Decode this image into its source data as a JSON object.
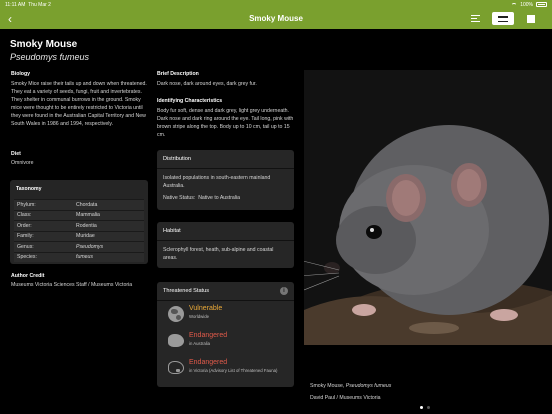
{
  "status_bar": {
    "time": "11:11 AM",
    "date": "Thu Mar 2",
    "battery": "100%"
  },
  "navbar": {
    "title": "Smoky Mouse"
  },
  "species": {
    "common_name": "Smoky Mouse",
    "scientific_name": "Pseudomys fumeus"
  },
  "biology": {
    "heading": "Biology",
    "text": "Smoky Mice raise their tails up and down when threatened. They eat a variety of seeds, fungi, fruit and invertebrates. They shelter in communal burrows in the ground. Smoky mice were thought to be entirely restricted to Victoria until they were found in the Australian Capital Territory and New South Wales in 1986 and 1994, respectively."
  },
  "diet": {
    "heading": "Diet",
    "text": "Omnivore"
  },
  "taxonomy": {
    "heading": "Taxonomy",
    "rows": [
      {
        "key": "Phylum:",
        "value": "Chordata"
      },
      {
        "key": "Class:",
        "value": "Mammalia"
      },
      {
        "key": "Order:",
        "value": "Rodentia"
      },
      {
        "key": "Family:",
        "value": "Muridae"
      },
      {
        "key": "Genus:",
        "value": "Pseudomys"
      },
      {
        "key": "Species:",
        "value": "fumeus"
      }
    ]
  },
  "author_credit": {
    "heading": "Author Credit",
    "text": "Museums Victoria Sciences Staff / Museums Victoria"
  },
  "brief_description": {
    "heading": "Brief Description",
    "text": "Dark nose, dark around eyes, dark grey fur."
  },
  "identifying": {
    "heading": "Identifying Characteristics",
    "text": "Body fur soft, dense and dark grey, light grey underneath. Dark nose and dark ring around the eye. Tail long, pink with brown stripe along the top. Body up to 10 cm, tail up to 15 cm."
  },
  "distribution": {
    "heading": "Distribution",
    "text": "Isolated populations in south-eastern mainland Australia.",
    "native_label": "Native Status:",
    "native_value": "Native to Australia"
  },
  "habitat": {
    "heading": "Habitat",
    "text": "Sclerophyll forest, heath, sub-alpine and coastal areas."
  },
  "threatened": {
    "heading": "Threatened Status",
    "info": "i",
    "items": [
      {
        "status": "Vulnerable",
        "scope": "Worldwide",
        "icon": "globe-icon"
      },
      {
        "status": "Endangered",
        "scope": "in Australia",
        "icon": "australia-icon"
      },
      {
        "status": "Endangered",
        "scope": "in Victoria (Advisory List of Threatened Fauna)",
        "icon": "australia-outline-icon"
      }
    ]
  },
  "photo": {
    "caption_prefix": "Smoky Mouse, ",
    "caption_italic": "Pseudomys fumeus",
    "credit": "David Paul / Museums Victoria",
    "page_count": 2,
    "current_page": 1
  },
  "colors": {
    "accent": "#7aa02e",
    "vulnerable": "#e8a838",
    "endangered": "#e05a4a"
  }
}
